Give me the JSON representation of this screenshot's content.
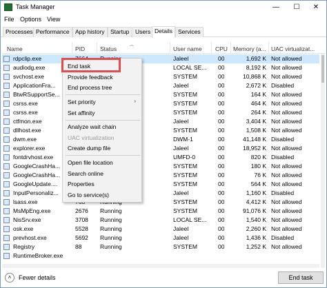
{
  "window": {
    "title": "Task Manager",
    "minimize": "—",
    "maximize": "☐",
    "close": "✕"
  },
  "menu": [
    "File",
    "Options",
    "View"
  ],
  "tabs": [
    "Processes",
    "Performance",
    "App history",
    "Startup",
    "Users",
    "Details",
    "Services"
  ],
  "active_tab": "Details",
  "columns": {
    "name": "Name",
    "pid": "PID",
    "status": "Status",
    "user": "User name",
    "cpu": "CPU",
    "memory": "Memory (a...",
    "uac": "UAC virtualizat..."
  },
  "rows": [
    {
      "name": "rdpclip.exe",
      "pid": "7664",
      "status": "Running",
      "user": "Jaleel",
      "cpu": "00",
      "mem": "1,692 K",
      "uac": "Not allowed",
      "selected": true
    },
    {
      "name": "audiodg.exe",
      "pid": "",
      "status": "",
      "user": "LOCAL SE...",
      "cpu": "00",
      "mem": "8,192 K",
      "uac": "Not allowed"
    },
    {
      "name": "svchost.exe",
      "pid": "",
      "status": "",
      "user": "SYSTEM",
      "cpu": "00",
      "mem": "10,868 K",
      "uac": "Not allowed"
    },
    {
      "name": "ApplicationFra...",
      "pid": "",
      "status": "",
      "user": "Jaleel",
      "cpu": "00",
      "mem": "2,672 K",
      "uac": "Disabled"
    },
    {
      "name": "BtwRSupportSe...",
      "pid": "",
      "status": "",
      "user": "SYSTEM",
      "cpu": "00",
      "mem": "164 K",
      "uac": "Not allowed"
    },
    {
      "name": "csrss.exe",
      "pid": "",
      "status": "",
      "user": "SYSTEM",
      "cpu": "00",
      "mem": "464 K",
      "uac": "Not allowed"
    },
    {
      "name": "csrss.exe",
      "pid": "",
      "status": "",
      "user": "SYSTEM",
      "cpu": "00",
      "mem": "264 K",
      "uac": "Not allowed"
    },
    {
      "name": "ctfmon.exe",
      "pid": "",
      "status": "",
      "user": "Jaleel",
      "cpu": "00",
      "mem": "3,404 K",
      "uac": "Not allowed"
    },
    {
      "name": "dllhost.exe",
      "pid": "",
      "status": "",
      "user": "SYSTEM",
      "cpu": "00",
      "mem": "1,508 K",
      "uac": "Not allowed"
    },
    {
      "name": "dwm.exe",
      "pid": "",
      "status": "",
      "user": "DWM-1",
      "cpu": "00",
      "mem": "41,148 K",
      "uac": "Disabled"
    },
    {
      "name": "explorer.exe",
      "pid": "",
      "status": "",
      "user": "Jaleel",
      "cpu": "00",
      "mem": "18,952 K",
      "uac": "Not allowed"
    },
    {
      "name": "fontdrvhost.exe",
      "pid": "",
      "status": "",
      "user": "UMFD-0",
      "cpu": "00",
      "mem": "820 K",
      "uac": "Disabled"
    },
    {
      "name": "GoogleCrashHa...",
      "pid": "",
      "status": "",
      "user": "SYSTEM",
      "cpu": "00",
      "mem": "180 K",
      "uac": "Not allowed"
    },
    {
      "name": "GoogleCrashHa...",
      "pid": "",
      "status": "",
      "user": "SYSTEM",
      "cpu": "00",
      "mem": "76 K",
      "uac": "Not allowed"
    },
    {
      "name": "GoogleUpdate....",
      "pid": "",
      "status": "",
      "user": "SYSTEM",
      "cpu": "00",
      "mem": "564 K",
      "uac": "Not allowed"
    },
    {
      "name": "InputPersonaliz...",
      "pid": "",
      "status": "",
      "user": "Jaleel",
      "cpu": "00",
      "mem": "1,160 K",
      "uac": "Disabled"
    },
    {
      "name": "lsass.exe",
      "pid": "768",
      "status": "Running",
      "user": "SYSTEM",
      "cpu": "00",
      "mem": "4,412 K",
      "uac": "Not allowed"
    },
    {
      "name": "MsMpEng.exe",
      "pid": "2676",
      "status": "Running",
      "user": "SYSTEM",
      "cpu": "00",
      "mem": "91,076 K",
      "uac": "Not allowed"
    },
    {
      "name": "NisSrv.exe",
      "pid": "3708",
      "status": "Running",
      "user": "LOCAL SE...",
      "cpu": "00",
      "mem": "1,540 K",
      "uac": "Not allowed"
    },
    {
      "name": "osk.exe",
      "pid": "5528",
      "status": "Running",
      "user": "Jaleel",
      "cpu": "00",
      "mem": "2,260 K",
      "uac": "Not allowed"
    },
    {
      "name": "prevhost.exe",
      "pid": "5692",
      "status": "Running",
      "user": "Jaleel",
      "cpu": "00",
      "mem": "1,436 K",
      "uac": "Disabled"
    },
    {
      "name": "Registry",
      "pid": "88",
      "status": "Running",
      "user": "SYSTEM",
      "cpu": "00",
      "mem": "1,252 K",
      "uac": "Not allowed"
    },
    {
      "name": "RuntimeBroker.exe",
      "pid": "",
      "status": "",
      "user": "",
      "cpu": "",
      "mem": "",
      "uac": ""
    }
  ],
  "context_menu": {
    "items": [
      {
        "label": "End task",
        "enabled": true
      },
      {
        "label": "Provide feedback",
        "enabled": true
      },
      {
        "label": "End process tree",
        "enabled": true
      },
      {
        "label": "Set priority",
        "enabled": true,
        "submenu": true
      },
      {
        "label": "Set affinity",
        "enabled": true
      },
      {
        "label": "Analyze wait chain",
        "enabled": true
      },
      {
        "label": "UAC virtualization",
        "enabled": false
      },
      {
        "label": "Create dump file",
        "enabled": true
      },
      {
        "label": "Open file location",
        "enabled": true
      },
      {
        "label": "Search online",
        "enabled": true
      },
      {
        "label": "Properties",
        "enabled": true
      },
      {
        "label": "Go to service(s)",
        "enabled": true
      }
    ],
    "highlight_color": "#e54b4b"
  },
  "footer": {
    "fewer_details": "Fewer details",
    "end_task": "End task"
  },
  "colors": {
    "selected_row": "#cce8ff",
    "accent_border": "#7a9cc6"
  }
}
